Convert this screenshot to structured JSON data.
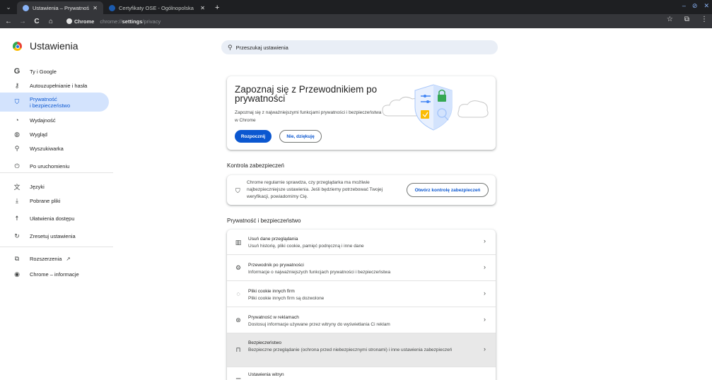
{
  "tabs": [
    {
      "title": "Ustawienia – Prywatność i bez",
      "close": "✕",
      "active": true
    },
    {
      "title": "Certyfikaty OSE - Ogólnopolska",
      "close": "✕",
      "active": false
    }
  ],
  "tab_menu_icon": "chevron-down-icon",
  "new_tab": "+",
  "window_controls": [
    "–",
    "⊘",
    "✕"
  ],
  "toolbar": {
    "back": "←",
    "forward": "→",
    "reload": "C",
    "home": "⌂",
    "chip_label": "Chrome",
    "url_scheme": "chrome://",
    "url_host": "settings",
    "url_path": "/privacy",
    "bookmark": "☆",
    "extensions": "⧉",
    "menu": "⋮"
  },
  "settings": {
    "title": "Ustawienia",
    "search_placeholder": "Przeszukaj ustawienia"
  },
  "sidebar": {
    "items": [
      {
        "label": "Ty i Google",
        "icon": "google-icon",
        "glyph": "G"
      },
      {
        "label": "Autouzupełnianie i hasła",
        "icon": "key-icon",
        "glyph": "⚷"
      },
      {
        "label": "Prywatność i bezpieczeństwo",
        "label1": "Prywatność",
        "label2": "i bezpieczeństwo",
        "icon": "shield-icon",
        "glyph": "⛉",
        "active": true
      },
      {
        "label": "Wydajność",
        "icon": "speedometer-icon",
        "glyph": "◔"
      },
      {
        "label": "Wygląd",
        "icon": "palette-icon",
        "glyph": "◍"
      },
      {
        "label": "Wyszukiwarka",
        "icon": "search-icon",
        "glyph": "⚲"
      },
      {
        "label": "Po uruchomieniu",
        "icon": "power-icon",
        "glyph": "⏻"
      },
      {
        "label": "Języki",
        "icon": "translate-icon",
        "glyph": "文"
      },
      {
        "label": "Pobrane pliki",
        "icon": "download-icon",
        "glyph": "⤓"
      },
      {
        "label": "Ułatwienia dostępu",
        "icon": "accessibility-icon",
        "glyph": "☨"
      },
      {
        "label": "Zresetuj ustawienia",
        "icon": "reset-icon",
        "glyph": "↻"
      },
      {
        "label": "Rozszerzenia",
        "icon": "puzzle-icon",
        "glyph": "⧉",
        "external": "↗"
      },
      {
        "label": "Chrome – informacje",
        "icon": "chrome-icon",
        "glyph": "◉"
      }
    ]
  },
  "guide_card": {
    "title": "Zapoznaj się z Przewodnikiem po prywatności",
    "description": "Zapoznaj się z najważniejszymi funkcjami prywatności i bezpieczeństwa w Chrome",
    "primary_button": "Rozpocznij",
    "secondary_button": "Nie, dziękuję"
  },
  "safety_check": {
    "section_title": "Kontrola zabezpieczeń",
    "text": "Chrome regularnie sprawdza, czy przeglądarka ma możliwie najbezpieczniejsze ustawienia. Jeśli będziemy potrzebować Twojej weryfikacji, powiadomimy Cię.",
    "button": "Otwórz kontrolę zabezpieczeń"
  },
  "privacy_section": {
    "section_title": "Prywatność i bezpieczeństwo",
    "rows": [
      {
        "title": "Usuń dane przeglądania",
        "subtitle": "Usuń historię, pliki cookie, pamięć podręczną i inne dane",
        "icon": "trash-icon",
        "glyph": "🗑"
      },
      {
        "title": "Przewodnik po prywatności",
        "subtitle": "Informacje o najważniejszych funkcjach prywatności i bezpieczeństwa",
        "icon": "guide-icon",
        "glyph": "⚙"
      },
      {
        "title": "Pliki cookie innych firm",
        "subtitle": "Pliki cookie innych firm są dozwolone",
        "icon": "cookie-icon",
        "glyph": "◌"
      },
      {
        "title": "Prywatność w reklamach",
        "subtitle": "Dostosuj informacje używane przez witryny do wyświetlania Ci reklam",
        "icon": "ad-privacy-icon",
        "glyph": "⊛"
      },
      {
        "title": "Bezpieczeństwo",
        "subtitle": "Bezpieczne przeglądanie (ochrona przed niebezpiecznymi stronami) i inne ustawienia zabezpieczeń",
        "icon": "lock-icon",
        "glyph": "🔒"
      },
      {
        "title": "Ustawienia witryn",
        "subtitle": "",
        "icon": "site-settings-icon",
        "glyph": "☰"
      }
    ],
    "chevron": "›"
  },
  "colors": {
    "accent": "#0b57d0",
    "active_nav_bg": "#d3e3fd",
    "search_bg": "#e9eef6",
    "hover_row": "#e8e8e8",
    "browser_frame": "#35363a"
  }
}
